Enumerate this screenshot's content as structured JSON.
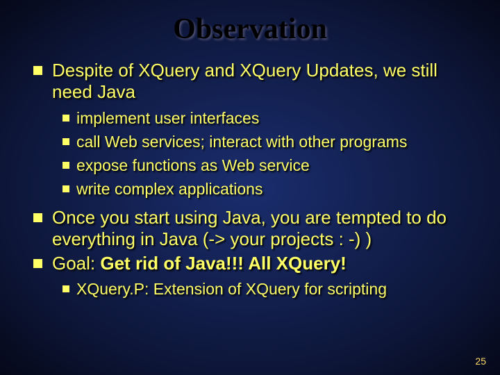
{
  "title": "Observation",
  "bullets": [
    {
      "text": "Despite of XQuery and XQuery Updates, we still need Java",
      "sub": [
        "implement user interfaces",
        "call Web services; interact with other programs",
        "expose functions as Web service",
        "write complex applications"
      ]
    },
    {
      "text": "Once you start using Java, you are tempted to do everything in Java (-> your projects : -) )"
    },
    {
      "text_pre": "Goal: ",
      "text_bold": "Get rid of Java!!!  All XQuery!",
      "sub": [
        "XQuery.P:  Extension of XQuery for scripting"
      ]
    }
  ],
  "page_number": "25"
}
